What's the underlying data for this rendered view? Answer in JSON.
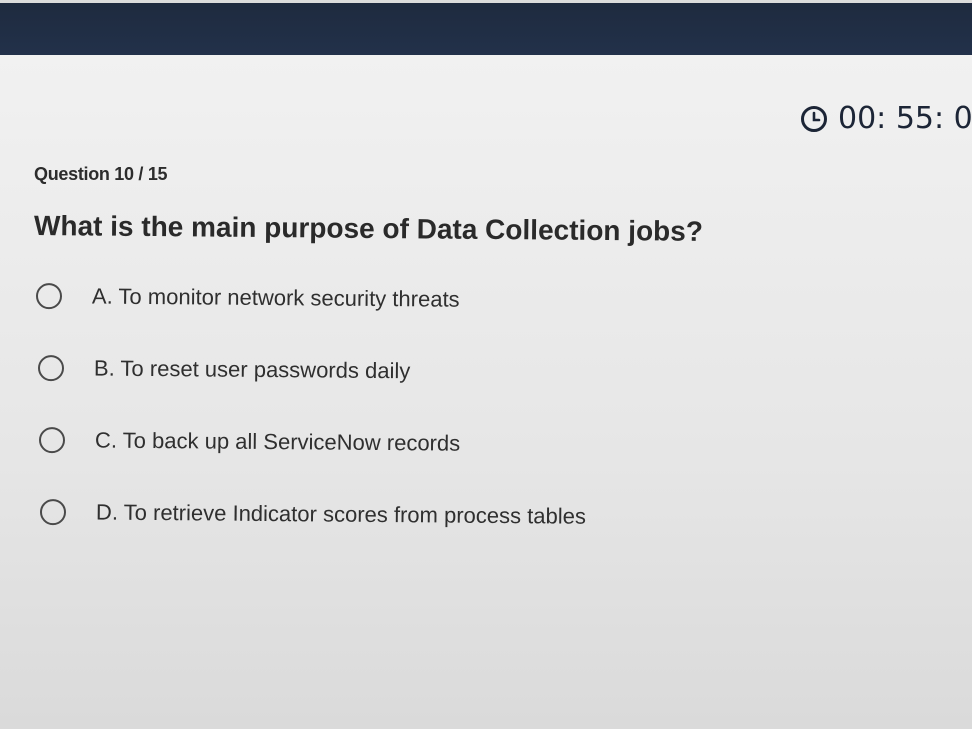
{
  "timer": {
    "display": "00: 55: 0",
    "icon": "clock-icon"
  },
  "question": {
    "counter": "Question 10 / 15",
    "text": "What is the main purpose of Data Collection jobs?"
  },
  "options": [
    {
      "label": "A. To monitor network security threats",
      "selected": false
    },
    {
      "label": "B. To reset user passwords daily",
      "selected": false
    },
    {
      "label": "C. To back up all ServiceNow records",
      "selected": false
    },
    {
      "label": "D. To retrieve Indicator scores from process tables",
      "selected": false
    }
  ],
  "colors": {
    "header": "#1e2a3e",
    "background": "#e9e9e9",
    "text": "#2a2a2a"
  }
}
